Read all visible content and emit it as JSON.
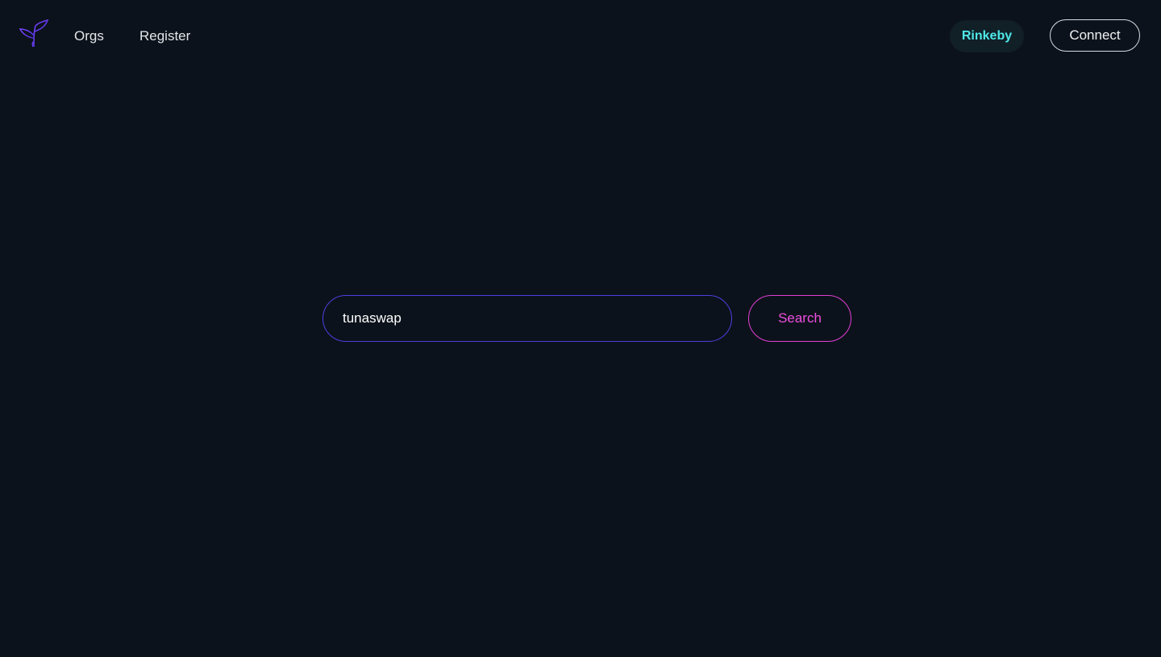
{
  "header": {
    "logo_icon": "sprout-icon",
    "nav": [
      {
        "label": "Orgs"
      },
      {
        "label": "Register"
      }
    ],
    "network_label": "Rinkeby",
    "connect_label": "Connect"
  },
  "search": {
    "value": "tunaswap",
    "button_label": "Search"
  },
  "colors": {
    "background": "#0c121b",
    "network_text": "#4fe8e8",
    "network_bg": "#111f27",
    "search_border": "#4a40e0",
    "search_button": "#e23fd5"
  }
}
